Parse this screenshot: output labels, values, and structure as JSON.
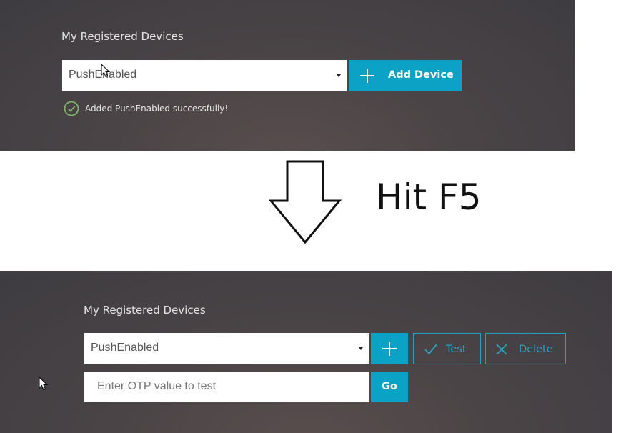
{
  "before_refresh": {
    "section_title": "My Registered Devices",
    "device_select": {
      "selected": "PushEnabled"
    },
    "add_device_label": "Add Device",
    "status_message": "Added PushEnabled successfully!",
    "status_color": "#7fb56b"
  },
  "annotation": {
    "text": "Hit F5",
    "arrow_icon": "down-arrow-icon"
  },
  "after_refresh": {
    "section_title": "My Registered Devices",
    "device_select": {
      "selected": "PushEnabled"
    },
    "test_label": "Test",
    "delete_label": "Delete",
    "otp_input": {
      "placeholder": "Enter OTP value to test",
      "value": ""
    },
    "go_label": "Go"
  },
  "colors": {
    "accent": "#0ba2c5",
    "panel_background": "#443f43"
  }
}
